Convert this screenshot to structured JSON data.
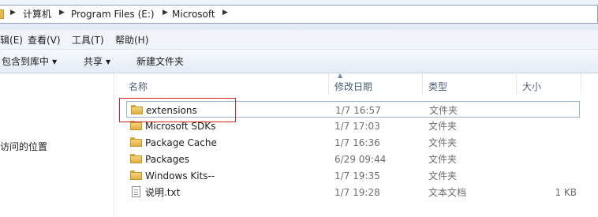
{
  "address": {
    "crumbs": [
      "计算机",
      "Program Files (E:)",
      "Microsoft"
    ],
    "icon": "folder-icon"
  },
  "menu": {
    "items": [
      "编辑(E)",
      "查看(V)",
      "工具(T)",
      "帮助(H)"
    ],
    "first_visible": "(E)"
  },
  "toolbar": {
    "include_library": "包含到库中",
    "share": "共享",
    "new_folder": "新建文件夹"
  },
  "nav": {
    "recent_places": "访问的位置",
    "recent_places_visible": "访问的位置"
  },
  "columns": {
    "name": "名称",
    "date": "修改日期",
    "type": "类型",
    "size": "大小"
  },
  "files": [
    {
      "name": "extensions",
      "date": "1/7 16:57",
      "type": "文件夹",
      "size": "",
      "icon": "folder-icon",
      "selected": true
    },
    {
      "name": "Microsoft SDKs",
      "date": "1/7 17:03",
      "type": "文件夹",
      "size": "",
      "icon": "folder-icon"
    },
    {
      "name": "Package Cache",
      "date": "1/7 16:36",
      "type": "文件夹",
      "size": "",
      "icon": "folder-icon"
    },
    {
      "name": "Packages",
      "date": "6/29 09:44",
      "type": "文件夹",
      "size": "",
      "icon": "folder-icon"
    },
    {
      "name": "Windows Kits--",
      "date": "1/7 19:35",
      "type": "文件夹",
      "size": "",
      "icon": "folder-icon"
    },
    {
      "name": "说明.txt",
      "date": "1/7 19:28",
      "type": "文本文档",
      "size": "1 KB",
      "icon": "text-file-icon"
    }
  ],
  "colors": {
    "annotation_box": "#d22a2a",
    "selection_border": "#99b4d1"
  }
}
